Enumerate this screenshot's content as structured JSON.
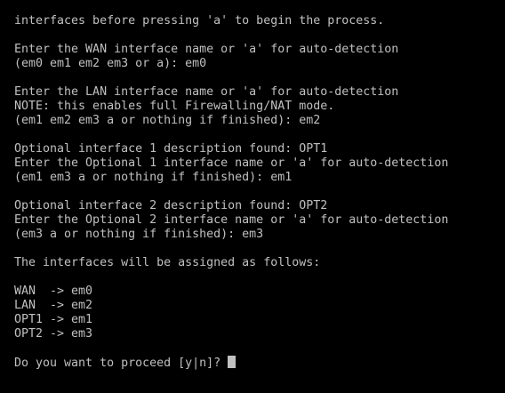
{
  "terminal": {
    "lines": [
      "interfaces before pressing 'a' to begin the process.",
      "",
      "Enter the WAN interface name or 'a' for auto-detection",
      "(em0 em1 em2 em3 or a): em0",
      "",
      "Enter the LAN interface name or 'a' for auto-detection",
      "NOTE: this enables full Firewalling/NAT mode.",
      "(em1 em2 em3 a or nothing if finished): em2",
      "",
      "Optional interface 1 description found: OPT1",
      "Enter the Optional 1 interface name or 'a' for auto-detection",
      "(em1 em3 a or nothing if finished): em1",
      "",
      "Optional interface 2 description found: OPT2",
      "Enter the Optional 2 interface name or 'a' for auto-detection",
      "(em3 a or nothing if finished): em3",
      "",
      "The interfaces will be assigned as follows:",
      "",
      "WAN  -> em0",
      "LAN  -> em2",
      "OPT1 -> em1",
      "OPT2 -> em3",
      "",
      "Do you want to proceed [y|n]? "
    ]
  },
  "colors": {
    "background": "#000000",
    "text": "#c0c0c0"
  }
}
